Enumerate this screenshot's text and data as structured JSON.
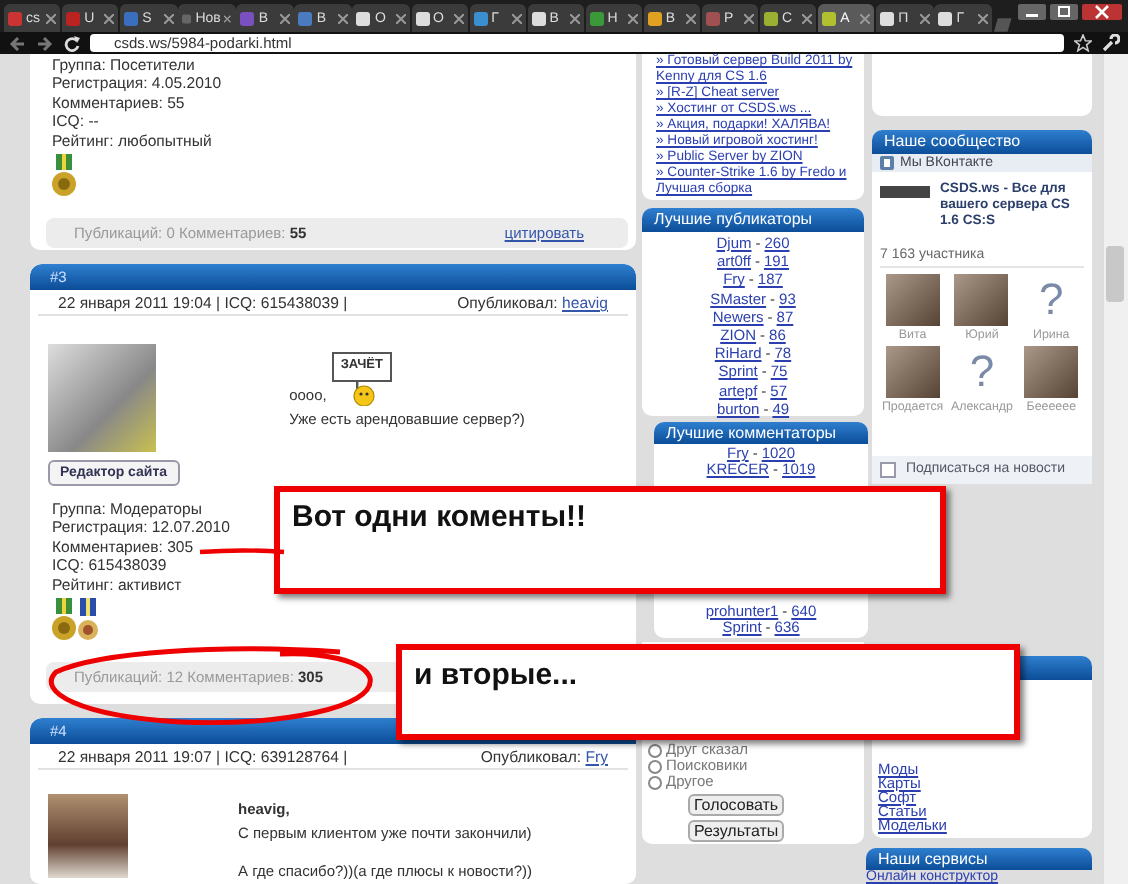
{
  "browser": {
    "tabs": [
      {
        "title": "cs",
        "selected": false
      },
      {
        "title": "U",
        "selected": false
      },
      {
        "title": "S",
        "selected": false
      },
      {
        "title": "Нов",
        "selected": false
      },
      {
        "title": "B",
        "selected": false
      },
      {
        "title": "B",
        "selected": false
      },
      {
        "title": "O",
        "selected": false
      },
      {
        "title": "O",
        "selected": false
      },
      {
        "title": "Г",
        "selected": false
      },
      {
        "title": "B",
        "selected": false
      },
      {
        "title": "H",
        "selected": false
      },
      {
        "title": "B",
        "selected": false
      },
      {
        "title": "P",
        "selected": false
      },
      {
        "title": "C",
        "selected": false
      },
      {
        "title": "A",
        "selected": true
      },
      {
        "title": "П",
        "selected": false
      },
      {
        "title": "Г",
        "selected": false
      }
    ],
    "address": "csds.ws/5984-podarki.html"
  },
  "posts": [
    {
      "kind": "tail",
      "user_info": [
        "Группа: Посетители",
        "Регистрация: 4.05.2010",
        "Комментариев: 55",
        "ICQ: --",
        "Рейтинг: любопытный"
      ],
      "awards": [
        {
          "kind": "gold"
        }
      ],
      "stats": "Публикаций: 0 Комментариев: **55**",
      "quote": "цитировать"
    },
    {
      "kind": "full",
      "number": "#3",
      "date": "22 января 2011 19:04 | ICQ: 615438039 |",
      "author_label": "Опубликовал:",
      "author": "heavig",
      "avatar_button": "Редактор сайта",
      "greeting": "oooo,",
      "sticker": "ЗАЧЁТ",
      "text": [
        "Уже есть арендовавшие сервер?)"
      ],
      "user_info": [
        "Группа: Модераторы",
        "Регистрация: 12.07.2010",
        "Комментариев: 305",
        "ICQ: 615438039",
        "Рейтинг: активист"
      ],
      "awards": [
        {
          "kind": "gold"
        },
        {
          "kind": "blue"
        }
      ],
      "stats": "Публикаций: 12 Комментариев: **305**"
    },
    {
      "kind": "full",
      "number": "#4",
      "date": "22 января 2011 19:07 | ICQ: 639128764 |",
      "author_label": "Опубликовал:",
      "author": "Fry",
      "addressee": "heavig,",
      "text": [
        "С первым клиентом уже почти закончили)",
        "А где спасибо?))(а где плюсы к новости?))"
      ]
    }
  ],
  "news_links": [
    "» Готовый сервер Build 2011 by Kenny для CS 1.6",
    "» [R-Z] Cheat server",
    "» Хостинг от CSDS.ws ...",
    "» Акция, подарки! ХАЛЯВА!",
    "» Новый игровой хостинг!",
    "» Public Server by ZION",
    "» Counter-Strike 1.6 by Fredo и Лучшая сборка"
  ],
  "top_publishers": {
    "title": "Лучшие публикаторы",
    "separator": "-",
    "items": [
      {
        "name": "Djum",
        "count": "260"
      },
      {
        "name": "art0ff",
        "count": "191"
      },
      {
        "name": "Fry",
        "count": "187"
      },
      {
        "name": "SMaster",
        "count": "93"
      },
      {
        "name": "Newers",
        "count": "87"
      },
      {
        "name": "ZION",
        "count": "86"
      },
      {
        "name": "RiHard",
        "count": "78"
      },
      {
        "name": "Sprint",
        "count": "75"
      },
      {
        "name": "artepf",
        "count": "57"
      },
      {
        "name": "burton",
        "count": "49"
      }
    ]
  },
  "top_commenters": {
    "title": "Лучшие комментаторы",
    "separator": "-",
    "items": [
      {
        "name": "Fry",
        "count": "1020"
      },
      {
        "name": "KRECER",
        "count": "1019"
      },
      {
        "name": "prohunter1",
        "count": "640"
      },
      {
        "name": "Sprint",
        "count": "636"
      }
    ]
  },
  "poll": {
    "options": [
      {
        "label": "Друг сказал",
        "selected": false
      },
      {
        "label": "Поисковики",
        "selected": false
      },
      {
        "label": "Другое",
        "selected": false
      }
    ],
    "buttons": [
      "Голосовать",
      "Результаты"
    ]
  },
  "community": {
    "title": "Наше сообщество",
    "vk_label": "Мы ВКонтакте",
    "group_name": "CSDS.ws - Все для вашего сервера CS 1.6 CS:S",
    "members_count": "7 163 участника",
    "members": [
      {
        "name": "Вита",
        "kind": "photo"
      },
      {
        "name": "Юрий",
        "kind": "photo"
      },
      {
        "name": "Ирина",
        "kind": "no-photo",
        "glyph": "?"
      },
      {
        "name": "Продается",
        "kind": "photo"
      },
      {
        "name": "Александр",
        "kind": "no-photo",
        "glyph": "?"
      },
      {
        "name": "Бееееее",
        "kind": "photo"
      }
    ],
    "subscribe": {
      "label": "Подписаться на новости",
      "checked": false
    }
  },
  "categories": [
    "Моды",
    "Карты",
    "Софт",
    "Статьи",
    "Модельки"
  ],
  "services": {
    "title": "Наши сервисы",
    "links": [
      "Онлайн конструктор"
    ]
  },
  "annotations": [
    {
      "kind": "callout",
      "text": "Вот одни коменты!!"
    },
    {
      "kind": "callout",
      "text": "и вторые..."
    },
    {
      "kind": "ellipse"
    },
    {
      "kind": "underline"
    }
  ]
}
